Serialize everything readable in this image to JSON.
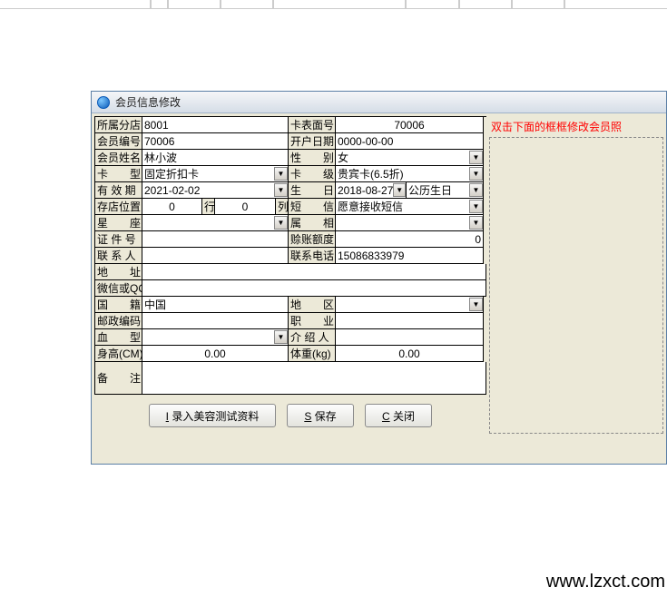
{
  "dialog": {
    "title": "会员信息修改"
  },
  "labels": {
    "branch": "所属分店",
    "cardface": "卡表面号",
    "memberno": "会员编号",
    "opendate": "开户日期",
    "name": "会员姓名",
    "gender": "性　　别",
    "cardtype": "卡　　型",
    "cardlevel": "卡　　级",
    "validto": "有 效 期",
    "birthday": "生　　日",
    "storepos": "存店位置",
    "rowchar": "行",
    "colchar": "列",
    "sms": "短　　信",
    "zodiac": "星　　座",
    "zh_zodiac": "属　　相",
    "idno": "证 件 号",
    "creditlimit": "赊账额度",
    "contact": "联 系 人",
    "phone": "联系电话",
    "address": "地　　址",
    "wechat": "微信或QQ",
    "nationality": "国　　籍",
    "region": "地　　区",
    "postcode": "邮政编码",
    "occupation": "职　　业",
    "bloodtype": "血　　型",
    "referrer": "介 绍 人",
    "height": "身高(CM)",
    "weight": "体重(kg)",
    "remark": "备　　注",
    "birthtype": "公历生日"
  },
  "values": {
    "branch": "8001",
    "cardface": "70006",
    "memberno": "70006",
    "opendate": "0000-00-00",
    "name": "林小波",
    "gender": "女",
    "cardtype": "固定折扣卡",
    "cardlevel": "贵宾卡(6.5折)",
    "validto": "2021-02-02",
    "birthday": "2018-08-27",
    "storepos": "0",
    "storerow": "0",
    "sms": "愿意接收短信",
    "zodiac": "",
    "zh_zodiac": "",
    "idno": "",
    "creditlimit": "0",
    "contact": "",
    "phone": "15086833979",
    "address": "",
    "wechat": "",
    "nationality": "中国",
    "region": "",
    "postcode": "",
    "occupation": "",
    "bloodtype": "",
    "referrer": "",
    "height": "0.00",
    "weight": "0.00",
    "remark": ""
  },
  "photo": {
    "hint": "双击下面的框框修改会员照"
  },
  "buttons": {
    "beauty_key": "I",
    "beauty_label": " 录入美容测试资料",
    "save_key": "S",
    "save_label": " 保存",
    "close_key": "C",
    "close_label": " 关闭"
  },
  "watermark": "www.lzxct.com"
}
